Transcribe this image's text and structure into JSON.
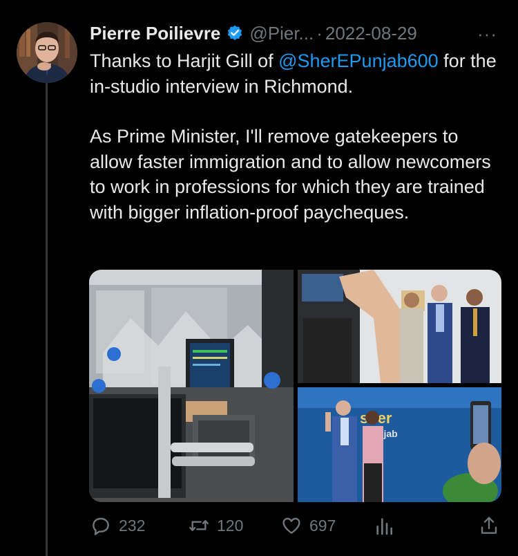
{
  "tweet": {
    "author": {
      "display_name": "Pierre Poilievre",
      "handle": "@Pier...",
      "verified_icon": "verified-badge-icon"
    },
    "separator": "·",
    "date": "2022-08-29",
    "more_label": "···",
    "text": {
      "line1_prefix": "Thanks to Harjit Gill of ",
      "mention": "@SherEPunjab600",
      "line1_suffix": " for the in-studio interview in Richmond.",
      "paragraph2": "As Prime Minister, I'll remove gatekeepers to allow faster immigration and to allow newcomers to work in professions for which they are trained with bigger inflation-proof paycheques."
    },
    "media": {
      "photos": [
        {
          "description": "radio-studio-photo"
        },
        {
          "description": "group-photo"
        },
        {
          "description": "photo-with-host"
        }
      ],
      "sign_text": "sher\nPunjab"
    },
    "actions": {
      "replies": "232",
      "reposts": "120",
      "likes": "697"
    }
  },
  "colors": {
    "background": "#000000",
    "text": "#e7e9ea",
    "secondary": "#71767b",
    "link": "#1d9bf0",
    "thread_line": "#333639"
  }
}
